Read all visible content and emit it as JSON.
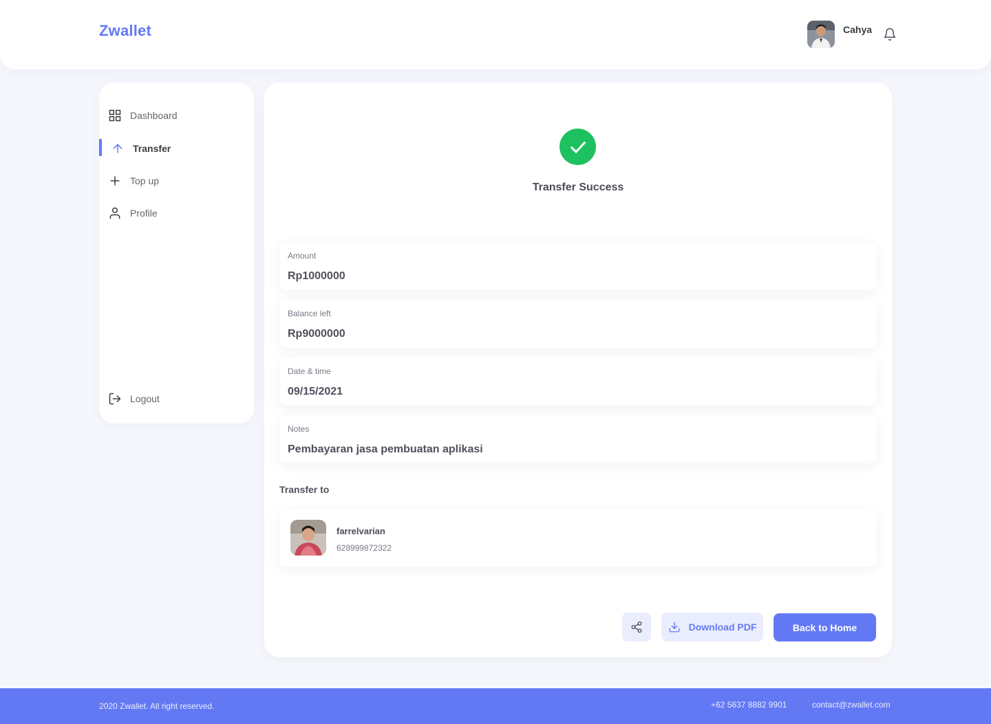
{
  "header": {
    "brand": "Zwallet",
    "user_name": "Cahya"
  },
  "sidebar": {
    "items": [
      {
        "label": "Dashboard",
        "icon": "grid-icon"
      },
      {
        "label": "Transfer",
        "icon": "arrow-up-icon",
        "active": true
      },
      {
        "label": "Top up",
        "icon": "plus-icon"
      },
      {
        "label": "Profile",
        "icon": "user-icon"
      }
    ],
    "logout_label": "Logout"
  },
  "main": {
    "status_title": "Transfer Success",
    "details": [
      {
        "label": "Amount",
        "value": "Rp1000000"
      },
      {
        "label": "Balance left",
        "value": "Rp9000000"
      },
      {
        "label": "Date & time",
        "value": "09/15/2021"
      },
      {
        "label": "Notes",
        "value": "Pembayaran jasa pembuatan aplikasi"
      }
    ],
    "transfer_to_label": "Transfer to",
    "recipient": {
      "name": "farrelvarian",
      "phone": "628999872322"
    },
    "buttons": {
      "download_pdf": "Download PDF",
      "back_home": "Back to Home"
    }
  },
  "footer": {
    "copyright": "2020 Zwallet. All right reserved.",
    "phone": "+62 5637 8882 9901",
    "email": "contact@zwallet.com"
  },
  "colors": {
    "primary": "#6379f4",
    "success": "#1ec15f",
    "background": "#f5f7fd"
  }
}
